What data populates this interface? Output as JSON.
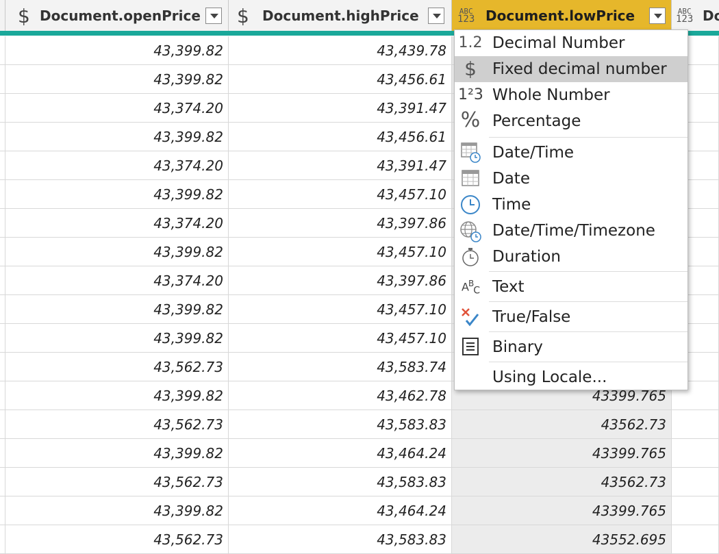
{
  "header": {
    "columns": [
      {
        "type_icon": "currency-icon",
        "icon_glyph": "$",
        "title": "Document.openPrice"
      },
      {
        "type_icon": "currency-icon",
        "icon_glyph": "$",
        "title": "Document.highPrice"
      },
      {
        "type_icon": "any-type-icon",
        "icon_top": "ABC",
        "icon_bottom": "123",
        "title": "Document.lowPrice",
        "highlight_color": "#e6b72b"
      },
      {
        "type_icon": "any-type-icon",
        "icon_top": "ABC",
        "icon_bottom": "123",
        "title": "Do"
      }
    ]
  },
  "rows": [
    {
      "open": "43,399.82",
      "high": "43,439.78",
      "low": ""
    },
    {
      "open": "43,399.82",
      "high": "43,456.61",
      "low": ""
    },
    {
      "open": "43,374.20",
      "high": "43,391.47",
      "low": ""
    },
    {
      "open": "43,399.82",
      "high": "43,456.61",
      "low": ""
    },
    {
      "open": "43,374.20",
      "high": "43,391.47",
      "low": ""
    },
    {
      "open": "43,399.82",
      "high": "43,457.10",
      "low": ""
    },
    {
      "open": "43,374.20",
      "high": "43,397.86",
      "low": ""
    },
    {
      "open": "43,399.82",
      "high": "43,457.10",
      "low": ""
    },
    {
      "open": "43,374.20",
      "high": "43,397.86",
      "low": ""
    },
    {
      "open": "43,399.82",
      "high": "43,457.10",
      "low": ""
    },
    {
      "open": "43,399.82",
      "high": "43,457.10",
      "low": ""
    },
    {
      "open": "43,562.73",
      "high": "43,583.74",
      "low": ""
    },
    {
      "open": "43,399.82",
      "high": "43,462.78",
      "low": "43399.765"
    },
    {
      "open": "43,562.73",
      "high": "43,583.83",
      "low": "43562.73"
    },
    {
      "open": "43,399.82",
      "high": "43,464.24",
      "low": "43399.765"
    },
    {
      "open": "43,562.73",
      "high": "43,583.83",
      "low": "43562.73"
    },
    {
      "open": "43,399.82",
      "high": "43,464.24",
      "low": "43399.765"
    },
    {
      "open": "43,562.73",
      "high": "43,583.83",
      "low": "43552.695"
    }
  ],
  "type_menu": {
    "items": [
      {
        "icon": "decimal-number-icon",
        "glyph": "1.2",
        "label": "Decimal Number"
      },
      {
        "icon": "fixed-decimal-icon",
        "glyph": "$",
        "label": "Fixed decimal number",
        "selected": true
      },
      {
        "icon": "whole-number-icon",
        "glyph": "1²3",
        "label": "Whole Number"
      },
      {
        "icon": "percentage-icon",
        "glyph": "%",
        "label": "Percentage"
      },
      {
        "icon": "datetime-icon",
        "label": "Date/Time"
      },
      {
        "icon": "date-icon",
        "label": "Date"
      },
      {
        "icon": "time-icon",
        "label": "Time"
      },
      {
        "icon": "datetime-timezone-icon",
        "label": "Date/Time/Timezone"
      },
      {
        "icon": "duration-icon",
        "label": "Duration"
      },
      {
        "icon": "text-icon",
        "glyph": "ABC",
        "label": "Text"
      },
      {
        "icon": "true-false-icon",
        "label": "True/False"
      },
      {
        "icon": "binary-icon",
        "label": "Binary"
      },
      {
        "label": "Using Locale..."
      }
    ],
    "colors": {
      "selected_bg": "#cfcfcf",
      "accent_teal": "#1aa89a",
      "clock_blue": "#3a86c8",
      "cross_red": "#e0523a"
    }
  }
}
